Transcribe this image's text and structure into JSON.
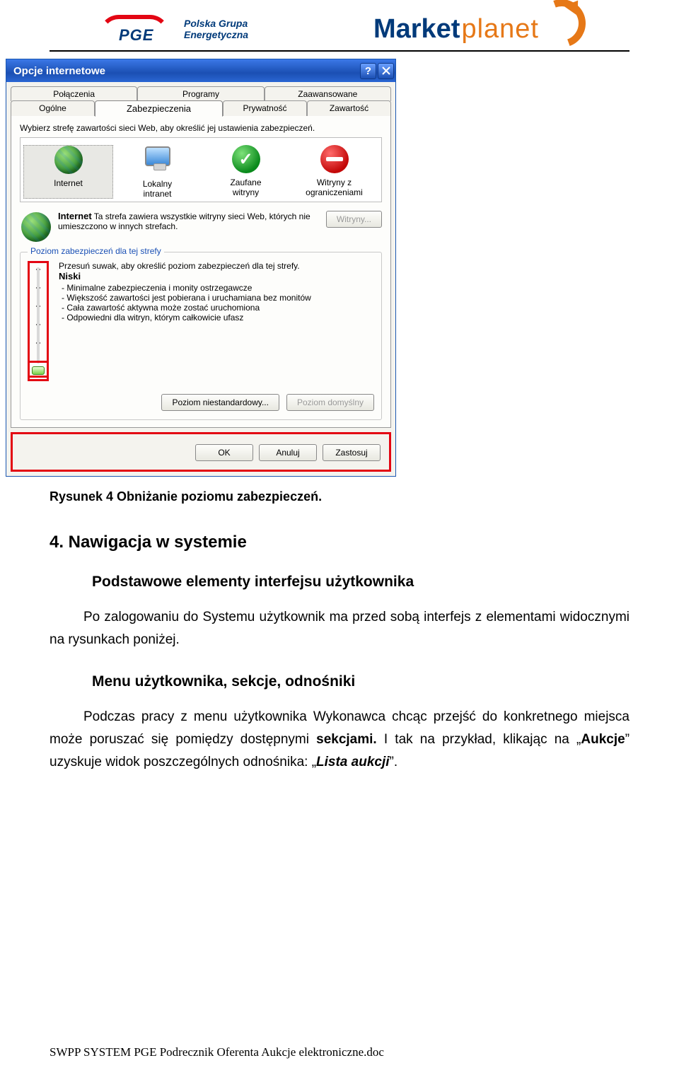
{
  "header": {
    "pge": "PGE",
    "pge_sub1": "Polska Grupa",
    "pge_sub2": "Energetyczna",
    "mp1": "Market",
    "mp2": "planet"
  },
  "dialog": {
    "title": "Opcje internetowe",
    "tabs_row1": [
      "Połączenia",
      "Programy",
      "Zaawansowane"
    ],
    "tabs_row2": [
      "Ogólne",
      "Zabezpieczenia",
      "Prywatność",
      "Zawartość"
    ],
    "active_tab": "Zabezpieczenia",
    "instruction": "Wybierz strefę zawartości sieci Web, aby określić jej ustawienia zabezpieczeń.",
    "zones": [
      {
        "label": "Internet"
      },
      {
        "label1": "Lokalny",
        "label2": "intranet"
      },
      {
        "label1": "Zaufane",
        "label2": "witryny"
      },
      {
        "label1": "Witryny z",
        "label2": "ograniczeniami"
      }
    ],
    "zone_detail": {
      "name": "Internet",
      "desc": "Ta strefa zawiera wszystkie witryny sieci Web, których nie umieszczono w innych strefach.",
      "sites_btn": "Witryny..."
    },
    "group": {
      "title": "Poziom zabezpieczeń dla tej strefy",
      "hint": "Przesuń suwak, aby określić poziom zabezpieczeń dla tej strefy.",
      "level": "Niski",
      "bullets": [
        "- Minimalne zabezpieczenia i monity ostrzegawcze",
        "- Większość zawartości jest pobierana i uruchamiana bez monitów",
        "- Cała zawartość aktywna może zostać uruchomiona",
        "- Odpowiedni dla witryn, którym całkowicie ufasz"
      ],
      "custom_btn": "Poziom niestandardowy...",
      "default_btn": "Poziom domyślny"
    },
    "buttons": {
      "ok": "OK",
      "cancel": "Anuluj",
      "apply": "Zastosuj"
    }
  },
  "doc": {
    "caption": "Rysunek 4 Obniżanie poziomu zabezpieczeń.",
    "h2": "4. Nawigacja w systemie",
    "h3a": "Podstawowe elementy interfejsu użytkownika",
    "para1": "Po zalogowaniu do Systemu użytkownik ma przed sobą interfejs z elementami widocznymi na rysunkach poniżej.",
    "h3b": "Menu użytkownika, sekcje, odnośniki",
    "para2_a": "Podczas pracy z menu użytkownika Wykonawca chcąc przejść do konkretnego miejsca może poruszać się pomiędzy dostępnymi ",
    "para2_bold1": "sekcjami.",
    "para2_b": " I tak na przykład, klikając na „",
    "para2_bold2": "Aukcje",
    "para2_c": "” uzyskuje widok poszczególnych odnośnika: „",
    "para2_bold3": "Lista aukcji",
    "para2_d": "”."
  },
  "footer": "SWPP SYSTEM PGE Podrecznik Oferenta Aukcje elektroniczne.doc"
}
